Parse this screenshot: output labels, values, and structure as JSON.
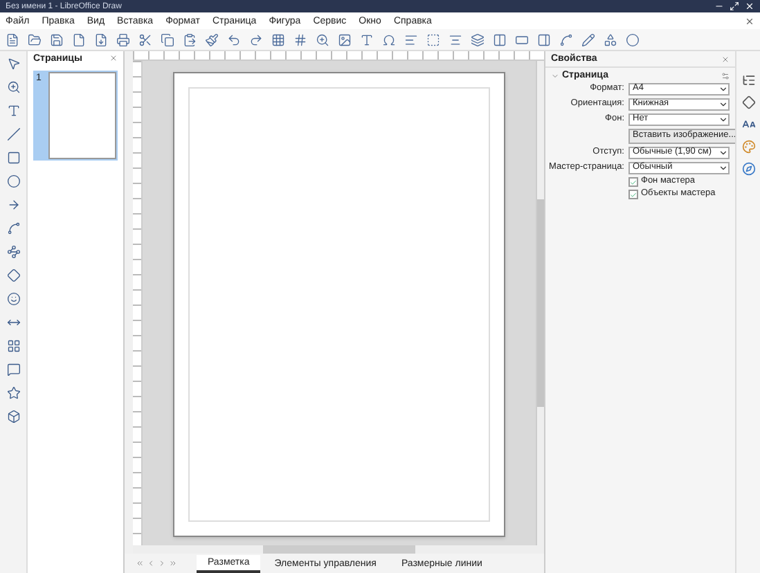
{
  "window": {
    "title": "Без имени 1 - LibreOffice Draw"
  },
  "menu": [
    "Файл",
    "Правка",
    "Вид",
    "Вставка",
    "Формат",
    "Страница",
    "Фигура",
    "Сервис",
    "Окно",
    "Справка"
  ],
  "slides_panel": {
    "title": "Страницы",
    "pages": [
      {
        "number": "1",
        "selected": true
      }
    ]
  },
  "properties": {
    "title": "Свойства",
    "section": "Страница",
    "fields": [
      {
        "kind": "select",
        "label": "Формат:",
        "value": "A4"
      },
      {
        "kind": "select",
        "label": "Ориентация:",
        "value": "Книжная"
      },
      {
        "kind": "select",
        "label": "Фон:",
        "value": "Нет"
      },
      {
        "kind": "button",
        "label": "Вставить изображение..."
      },
      {
        "kind": "select",
        "label": "Отступ:",
        "value": "Обычные (1,90 см)"
      },
      {
        "kind": "select",
        "label": "Мастер-страница:",
        "value": "Обычный"
      },
      {
        "kind": "checkbox",
        "label": "Фон мастера",
        "checked": true
      },
      {
        "kind": "checkbox",
        "label": "Объекты мастера",
        "checked": true
      }
    ]
  },
  "layer_tabs": [
    {
      "label": "Разметка",
      "selected": true
    },
    {
      "label": "Элементы управления",
      "selected": false
    },
    {
      "label": "Размерные линии",
      "selected": false
    }
  ]
}
